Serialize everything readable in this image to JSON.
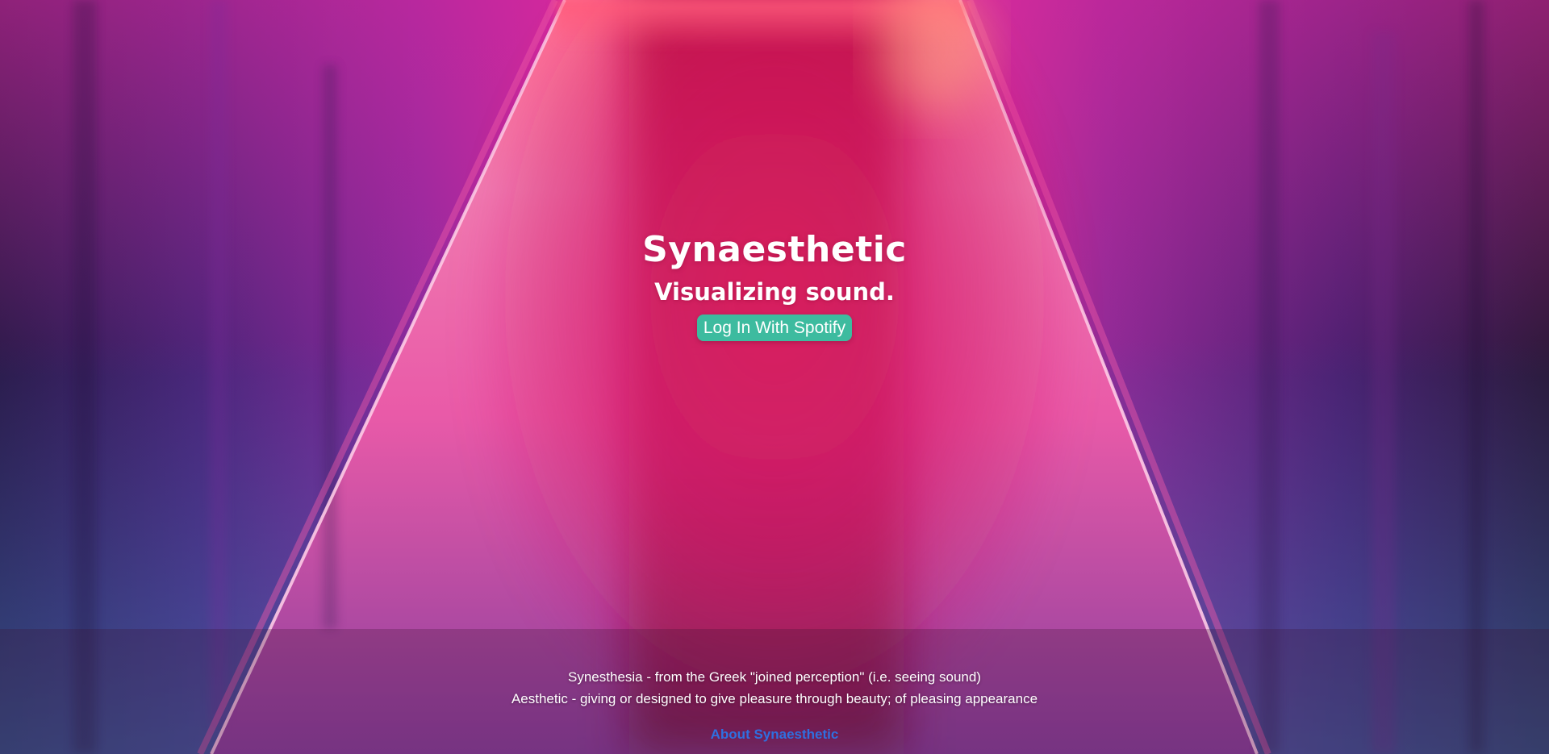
{
  "hero": {
    "title": "Synaesthetic",
    "tagline": "Visualizing sound.",
    "login_button_label": "Log In With Spotify"
  },
  "definitions": {
    "synesthesia": "Synesthesia - from the Greek \"joined perception\" (i.e. seeing sound)",
    "aesthetic": "Aesthetic - giving or designed to give pleasure through beauty; of pleasing appearance"
  },
  "footer": {
    "about_link_label": "About Synaesthetic"
  },
  "colors": {
    "login_button": "#3dbb9f",
    "about_link": "#2f6fe0",
    "corridor_floor": "#e81e63",
    "walls": "#3a1f5c"
  }
}
